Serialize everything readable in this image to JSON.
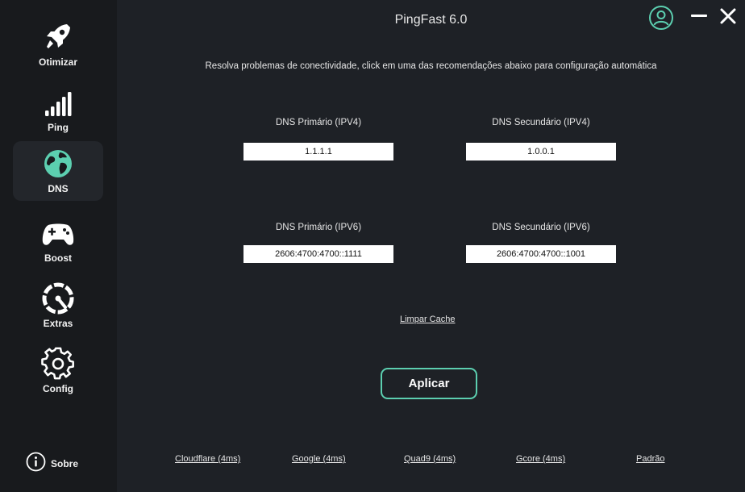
{
  "app": {
    "title": "PingFast 6.0"
  },
  "sidebar": {
    "items": [
      {
        "label": "Otimizar",
        "icon": "rocket-icon"
      },
      {
        "label": "Ping",
        "icon": "signal-bars-icon"
      },
      {
        "label": "DNS",
        "icon": "globe-icon",
        "active": true
      },
      {
        "label": "Boost",
        "icon": "gamepad-icon"
      },
      {
        "label": "Extras",
        "icon": "speedometer-icon"
      },
      {
        "label": "Config",
        "icon": "gear-icon"
      }
    ],
    "about": {
      "label": "Sobre",
      "icon": "info-icon"
    }
  },
  "main": {
    "subtitle": "Resolva problemas de conectividade, click em uma das recomendações abaixo para configuração automática",
    "ipv4": {
      "primary_label": "DNS Primário (IPV4)",
      "primary_value": "1.1.1.1",
      "secondary_label": "DNS Secundário (IPV4)",
      "secondary_value": "1.0.0.1"
    },
    "ipv6": {
      "primary_label": "DNS Primário (IPV6)",
      "primary_value": "2606:4700:4700::1111",
      "secondary_label": "DNS Secundário (IPV6)",
      "secondary_value": "2606:4700:4700::1001"
    },
    "clear_cache": "Limpar Cache",
    "apply": "Aplicar",
    "presets": [
      "Cloudflare (4ms)",
      "Google (4ms)",
      "Quad9 (4ms)",
      "Gcore (4ms)",
      "Padrão"
    ]
  },
  "colors": {
    "accent": "#5ccfb0",
    "sidebar_bg": "#181a1d",
    "main_bg": "#1e2126"
  }
}
